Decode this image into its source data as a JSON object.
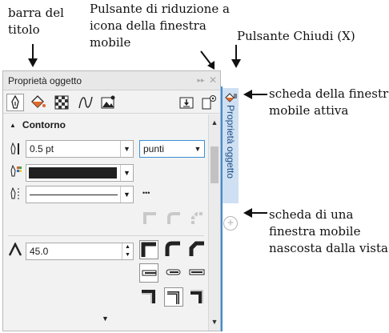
{
  "annotations": {
    "title_bar": [
      "barra del",
      "titolo"
    ],
    "minimize": [
      "Pulsante di riduzione a",
      "icona della finestra",
      "mobile"
    ],
    "close": [
      "Pulsante Chiudi (X)"
    ],
    "active_tab": [
      "scheda della finestra",
      "mobile attiva"
    ],
    "hidden_tab": [
      "scheda di una",
      "finestra mobile",
      "nascosta dalla vista"
    ]
  },
  "docker": {
    "title": "Proprietà oggetto",
    "collapse_glyph": "▸▸",
    "close_glyph": "✕",
    "section_label": "Contorno",
    "section_toggle": "▲",
    "outline_width": "0.5 pt",
    "units": "punti",
    "miter_limit": "45.0",
    "more_glyph": "▼",
    "dots": "•••",
    "vertical_tab": "Proprietà oggetto",
    "add_glyph": "+"
  },
  "colors": {
    "accent": "#3b8ed6",
    "tab_bg": "#cfe0f3",
    "outline_color": "#202020"
  }
}
